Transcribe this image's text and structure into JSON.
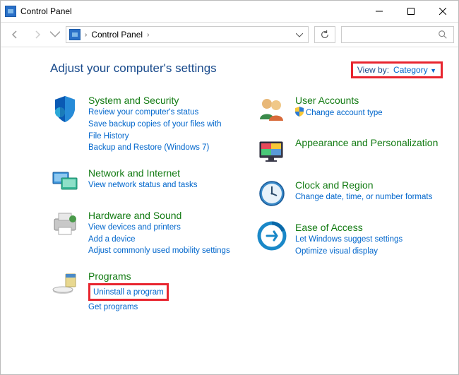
{
  "titlebar": {
    "title": "Control Panel"
  },
  "address": {
    "location": "Control Panel"
  },
  "heading": "Adjust your computer's settings",
  "viewby": {
    "label": "View by:",
    "value": "Category"
  },
  "left": [
    {
      "title": "System and Security",
      "links": [
        "Review your computer's status",
        "Save backup copies of your files with File History",
        "Backup and Restore (Windows 7)"
      ]
    },
    {
      "title": "Network and Internet",
      "links": [
        "View network status and tasks"
      ]
    },
    {
      "title": "Hardware and Sound",
      "links": [
        "View devices and printers",
        "Add a device",
        "Adjust commonly used mobility settings"
      ]
    },
    {
      "title": "Programs",
      "links": [
        "Uninstall a program",
        "Get programs"
      ]
    }
  ],
  "right": [
    {
      "title": "User Accounts",
      "links": [
        "Change account type"
      ],
      "shield": [
        true
      ]
    },
    {
      "title": "Appearance and Personalization",
      "links": []
    },
    {
      "title": "Clock and Region",
      "links": [
        "Change date, time, or number formats"
      ]
    },
    {
      "title": "Ease of Access",
      "links": [
        "Let Windows suggest settings",
        "Optimize visual display"
      ]
    }
  ]
}
